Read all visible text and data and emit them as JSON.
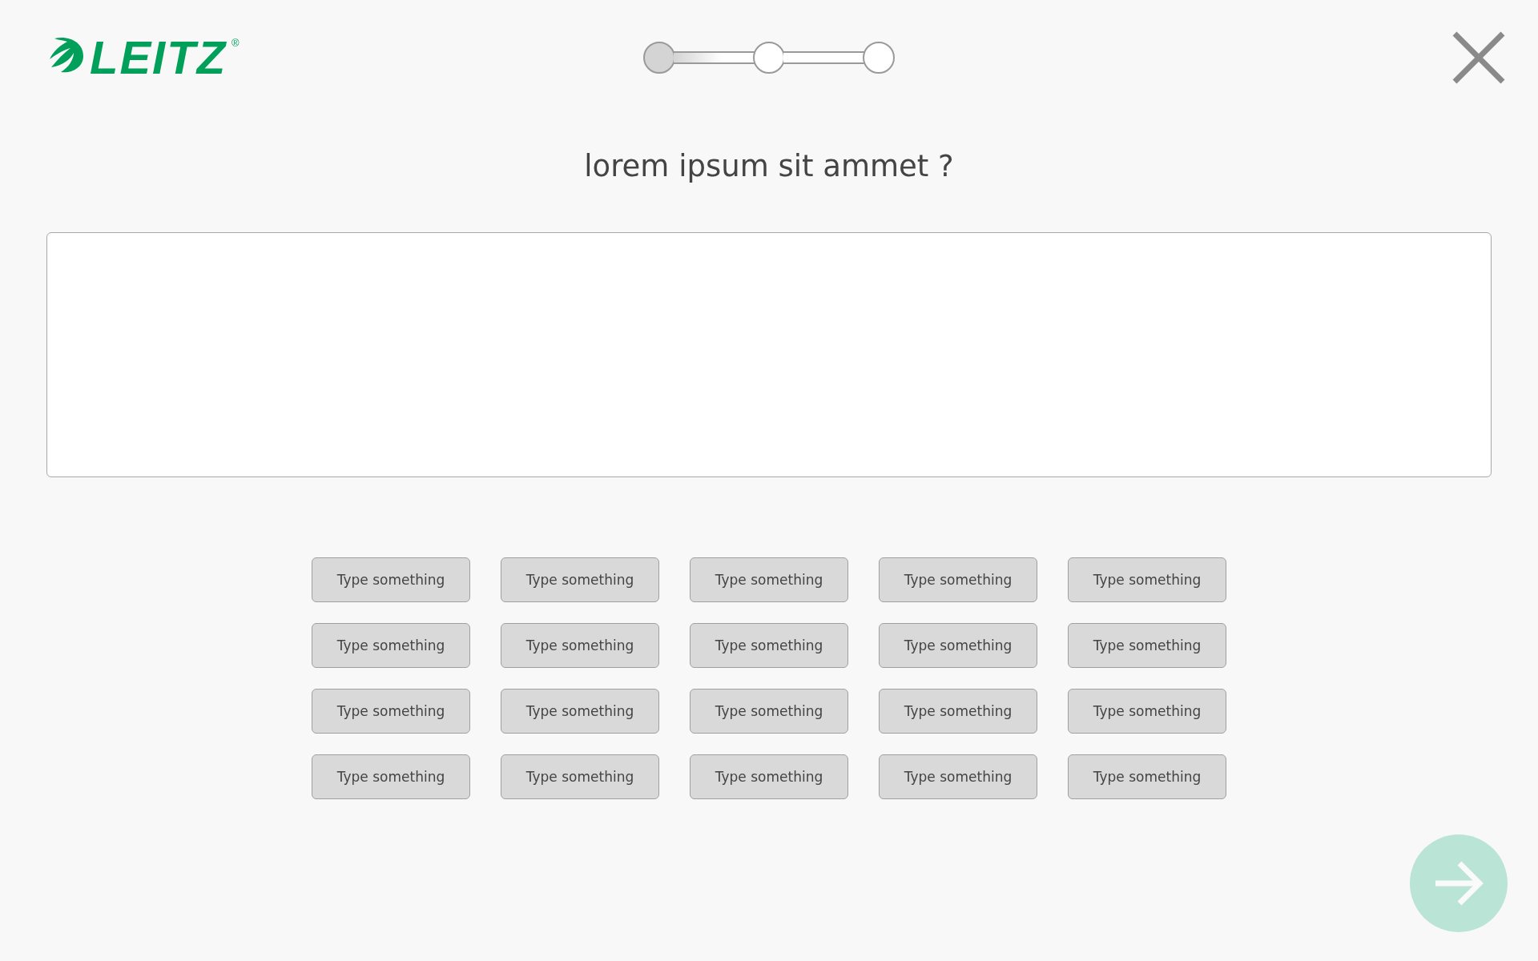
{
  "logo": {
    "wordmark": "LEITZ",
    "registered": "®"
  },
  "stepper": {
    "steps": [
      {
        "done": true
      },
      {
        "done": false
      },
      {
        "done": false
      }
    ]
  },
  "question": "lorem ipsum sit ammet ?",
  "options": [
    {
      "label": "Type something"
    },
    {
      "label": "Type something"
    },
    {
      "label": "Type something"
    },
    {
      "label": "Type something"
    },
    {
      "label": "Type something"
    },
    {
      "label": "Type something"
    },
    {
      "label": "Type something"
    },
    {
      "label": "Type something"
    },
    {
      "label": "Type something"
    },
    {
      "label": "Type something"
    },
    {
      "label": "Type something"
    },
    {
      "label": "Type something"
    },
    {
      "label": "Type something"
    },
    {
      "label": "Type something"
    },
    {
      "label": "Type something"
    },
    {
      "label": "Type something"
    },
    {
      "label": "Type something"
    },
    {
      "label": "Type something"
    },
    {
      "label": "Type something"
    },
    {
      "label": "Type something"
    }
  ],
  "next_button": {
    "disabled": true
  }
}
